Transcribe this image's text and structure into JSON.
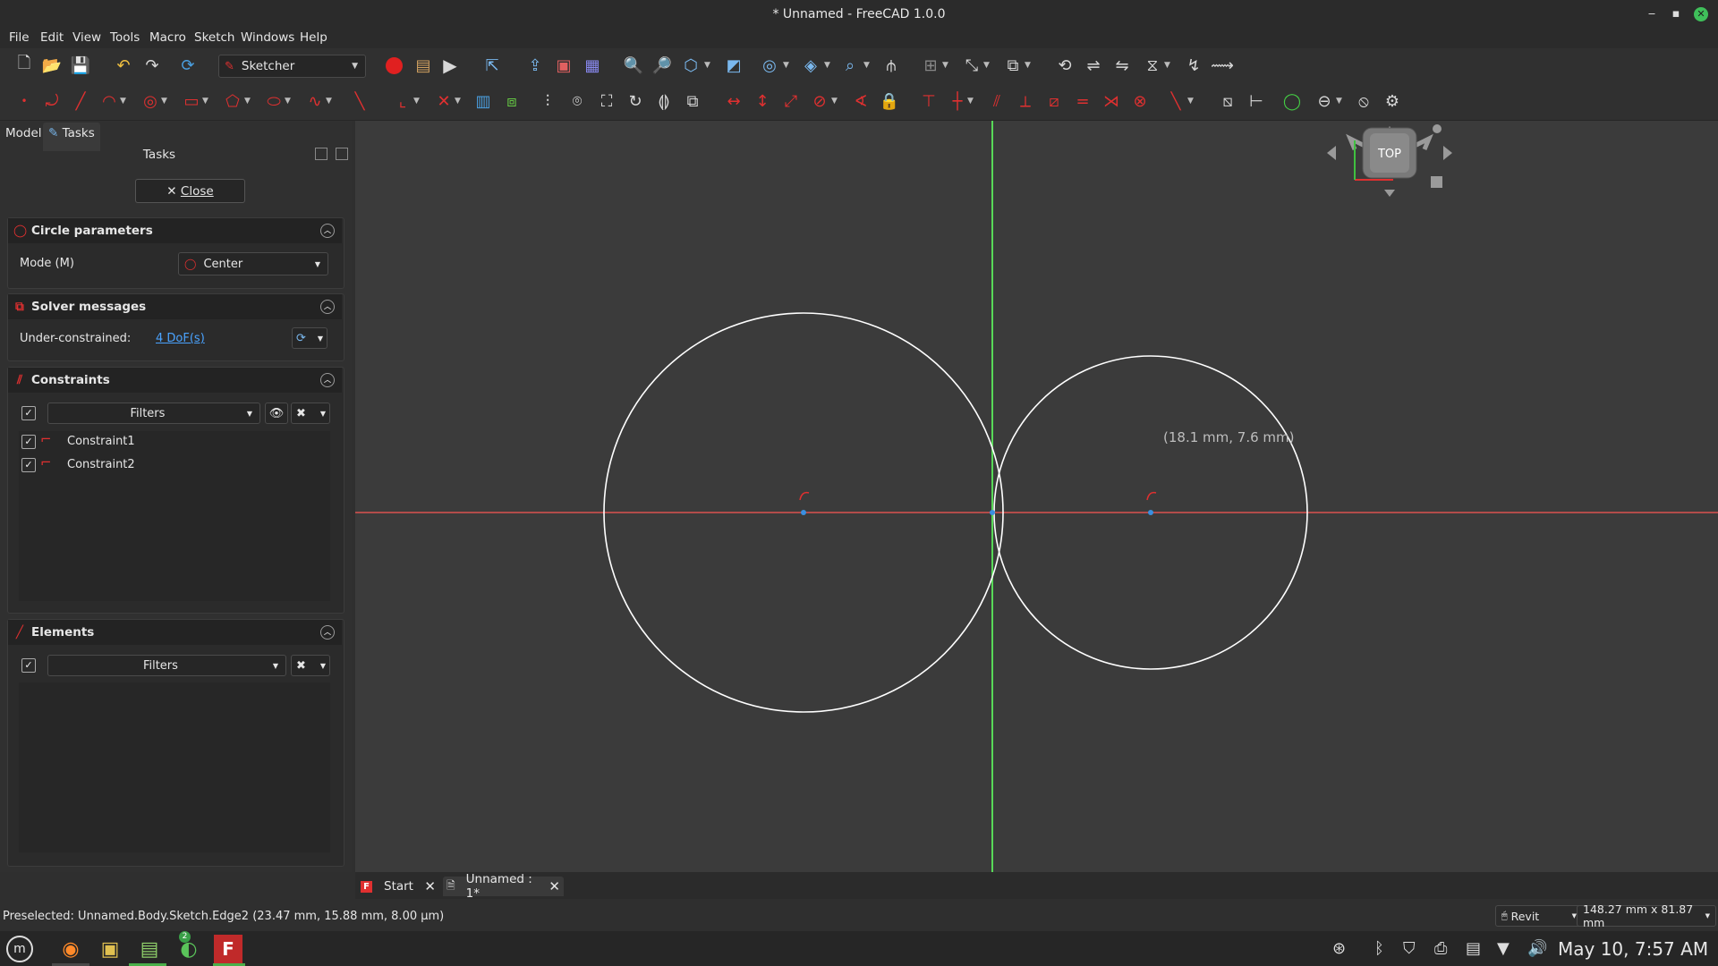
{
  "window": {
    "title": "* Unnamed - FreeCAD 1.0.0",
    "minimize": "‒",
    "maximize": "▪",
    "close": "✕"
  },
  "menu": [
    "File",
    "Edit",
    "View",
    "Tools",
    "Macro",
    "Sketch",
    "Windows",
    "Help"
  ],
  "workbench": {
    "label": "Sketcher"
  },
  "left_tabs": {
    "model": "Model",
    "tasks": "Tasks"
  },
  "tasks_panel": {
    "title": "Tasks",
    "close_label": "Close",
    "circle": {
      "title": "Circle parameters",
      "mode_label": "Mode (M)",
      "mode_value": "Center"
    },
    "solver": {
      "title": "Solver messages",
      "label": "Under-constrained:",
      "link": "4 DoF(s)"
    },
    "constraints": {
      "title": "Constraints",
      "filter": "Filters",
      "items": [
        "Constraint1",
        "Constraint2"
      ]
    },
    "elements": {
      "title": "Elements",
      "filter": "Filters"
    }
  },
  "viewport": {
    "coord_readout": "(18.1 mm, 7.6 mm)",
    "navcube": "TOP",
    "colors": {
      "h_axis": "#d9534f",
      "v_axis": "#58d858",
      "geometry": "#ffffff",
      "point": "#3a8fe0"
    }
  },
  "doc_tabs": [
    {
      "label": "Start"
    },
    {
      "label": "Unnamed : 1*"
    }
  ],
  "status": {
    "message": "Preselected: Unnamed.Body.Sketch.Edge2 (23.47 mm, 15.88 mm, 8.00 µm)",
    "nav_style": "Revit",
    "dimensions": "148.27 mm x 81.87 mm"
  },
  "taskbar": {
    "clock": "May 10,   7:57 AM",
    "badge": "2"
  }
}
